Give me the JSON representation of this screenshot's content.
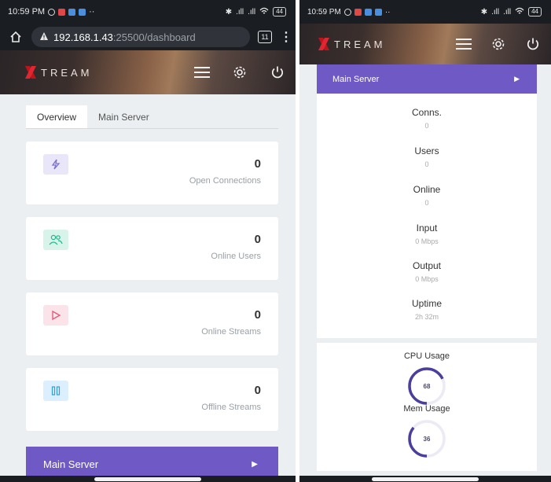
{
  "status_bar": {
    "time": "10:59 PM",
    "battery": "44"
  },
  "browser": {
    "url_host": "192.168.1.43",
    "url_rest": ":25500/dashboard",
    "tab_count": "11"
  },
  "app": {
    "logo_text": "TREAM",
    "brand_color": "#c0141c",
    "accent_color": "#6f59c4"
  },
  "tabs": [
    {
      "label": "Overview",
      "active": true
    },
    {
      "label": "Main Server",
      "active": false
    }
  ],
  "stats": [
    {
      "value": "0",
      "label": "Open Connections",
      "icon": "lightning-icon",
      "color": "#7b6fd1"
    },
    {
      "value": "0",
      "label": "Online Users",
      "icon": "users-icon",
      "color": "#26b589"
    },
    {
      "value": "0",
      "label": "Online Streams",
      "icon": "play-icon",
      "color": "#e0577a"
    },
    {
      "value": "0",
      "label": "Offline Streams",
      "icon": "pause-icon",
      "color": "#2f9fd8"
    }
  ],
  "server": {
    "title": "Main Server",
    "metrics": [
      {
        "label": "Conns.",
        "value": "0"
      },
      {
        "label": "Users",
        "value": "0"
      },
      {
        "label": "Online",
        "value": "0"
      },
      {
        "label": "Input",
        "value": "0 Mbps"
      },
      {
        "label": "Output",
        "value": "0 Mbps"
      },
      {
        "label": "Uptime",
        "value": "2h 32m"
      }
    ],
    "cpu": {
      "label": "CPU Usage",
      "value": "68",
      "fraction": 0.68
    },
    "mem": {
      "label": "Mem Usage",
      "value": "36",
      "fraction": 0.36
    }
  }
}
